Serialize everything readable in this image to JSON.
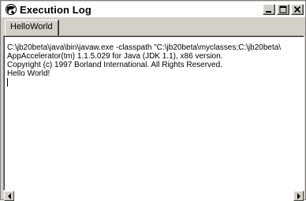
{
  "window": {
    "title": "Execution Log",
    "buttons": {
      "minimize_icon": "minimize-icon",
      "restore_icon": "restore-icon",
      "close_icon": "close-icon"
    }
  },
  "tabs": [
    {
      "label": "HelloWorld",
      "selected": true
    }
  ],
  "log": {
    "lines": [
      "C:\\jb20beta\\java\\bin\\javaw.exe -classpath \"C:\\jb20beta\\myclasses;C:\\jb20beta\\",
      "AppAccelerator(tm) 1.1.5.029 for Java (JDK 1.1), x86 version.",
      "Copyright (c) 1997 Borland International. All Rights Reserved.",
      "Hello World!"
    ]
  },
  "scrollbar": {
    "left_icon": "scroll-left-arrow-icon",
    "right_icon": "scroll-right-arrow-icon"
  }
}
